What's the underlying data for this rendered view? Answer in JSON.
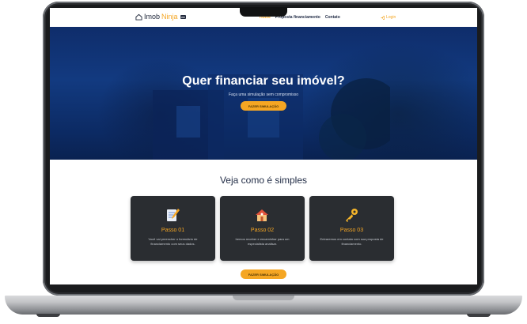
{
  "navbar": {
    "logo_part1": "Imob",
    "logo_part2": "Ninja",
    "logo_badge": "lab",
    "links": [
      "Home",
      "Proposta financiamento",
      "Contato"
    ],
    "login": "Login"
  },
  "hero": {
    "title": "Quer financiar seu imóvel?",
    "subtitle": "Faça uma simulação sem compromisso",
    "button": "FAZER SIMULAÇÃO"
  },
  "steps": {
    "title": "Veja como é simples",
    "cards": [
      {
        "icon": "form-icon",
        "title": "Passo 01",
        "text": "Você vai preencher o formulário de financiamento com seus dados."
      },
      {
        "icon": "house-icon",
        "title": "Passo 02",
        "text": "Iremos receber e encaminhar para um especialista analisar."
      },
      {
        "icon": "key-icon",
        "title": "Passo 03",
        "text": "Entraremos em contato com sua proposta de financiamento."
      }
    ],
    "button": "FAZER SIMULAÇÃO"
  },
  "colors": {
    "accent": "#f5a623",
    "hero_bg": "#123a80",
    "card_bg": "#2a2d31",
    "title_text": "#1f2a44"
  }
}
